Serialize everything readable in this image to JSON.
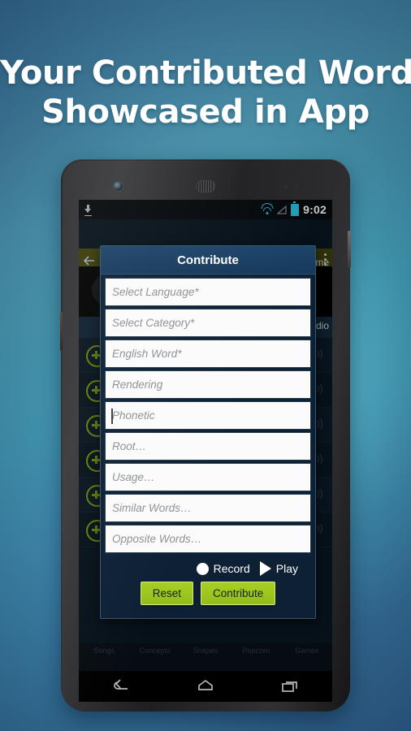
{
  "promo": {
    "headline_line1": "Your Contributed Words",
    "headline_line2": "Showcased in App",
    "bg_color": "#3f8ba5"
  },
  "statusbar": {
    "download_icon": "download-icon",
    "wifi_icon": "wifi-icon",
    "signal_icon": "signal-icon",
    "battery_icon": "battery-icon",
    "time": "9:02",
    "accent_color": "#2fc6e8"
  },
  "app_background": {
    "label_time": "ime",
    "label_audio": "udio",
    "add_icon": "plus-circle-icon",
    "speaker_icon": "speaker-icon",
    "tabs": [
      "Songs",
      "Concepts",
      "Shapes",
      "Popcorn",
      "Games"
    ]
  },
  "dialog": {
    "title": "Contribute",
    "fields": [
      {
        "name": "select-language",
        "placeholder": "Select Language*",
        "value": "",
        "focused": false
      },
      {
        "name": "select-category",
        "placeholder": "Select Category*",
        "value": "",
        "focused": false
      },
      {
        "name": "english-word",
        "placeholder": "English Word*",
        "value": "",
        "focused": false
      },
      {
        "name": "rendering",
        "placeholder": "Rendering",
        "value": "",
        "focused": false
      },
      {
        "name": "phonetic",
        "placeholder": "Phonetic",
        "value": "",
        "focused": true
      },
      {
        "name": "root",
        "placeholder": "Root…",
        "value": "",
        "focused": false
      },
      {
        "name": "usage",
        "placeholder": "Usage…",
        "value": "",
        "focused": false
      },
      {
        "name": "similar-words",
        "placeholder": "Similar Words…",
        "value": "",
        "focused": false
      },
      {
        "name": "opposite-words",
        "placeholder": "Opposite Words…",
        "value": "",
        "focused": false
      }
    ],
    "media": {
      "record_label": "Record",
      "record_icon": "record-circle-icon",
      "play_label": "Play",
      "play_icon": "play-triangle-icon"
    },
    "buttons": {
      "reset_label": "Reset",
      "contribute_label": "Contribute",
      "button_color": "#9dc81e"
    }
  },
  "chrome": {
    "back_icon": "back-arrow-icon",
    "overflow_icon": "overflow-menu-icon"
  },
  "navbar": {
    "back_icon": "nav-back-icon",
    "home_icon": "nav-home-icon",
    "recents_icon": "nav-recents-icon"
  }
}
